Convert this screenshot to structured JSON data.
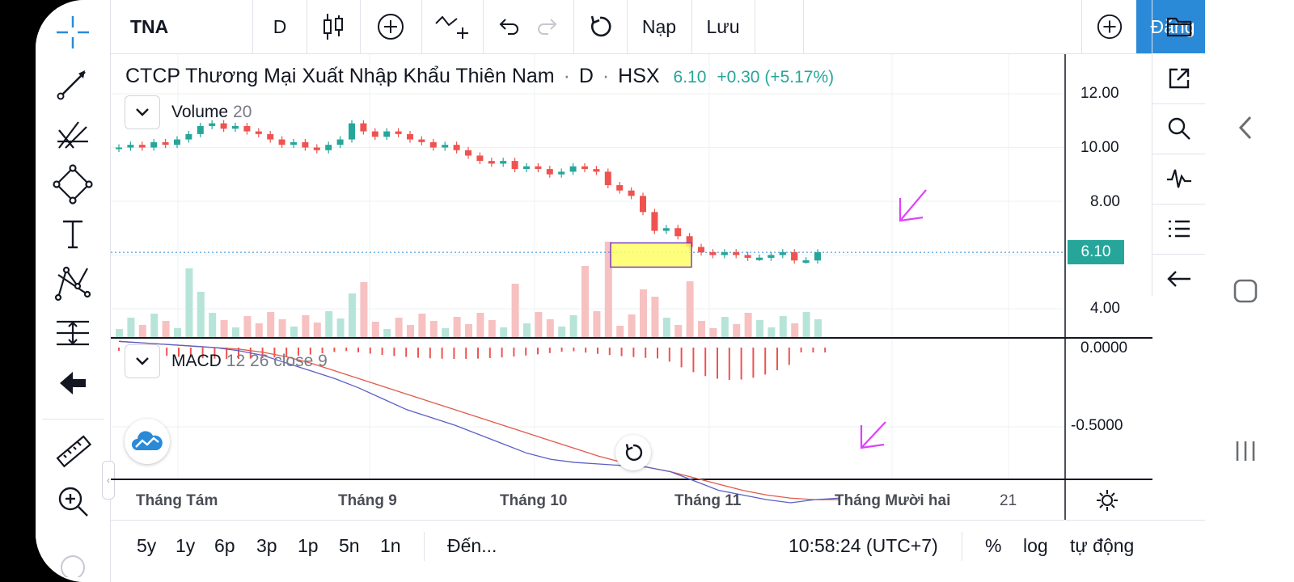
{
  "toolbar": {
    "symbol": "TNA",
    "interval": "D",
    "load_label": "Nạp",
    "save_label": "Lưu",
    "signup_label": "Đăng"
  },
  "legend": {
    "title": "CTCP Thương Mại Xuất Nhập Khẩu Thiên Nam",
    "sep1": "·",
    "interval": "D",
    "sep2": "·",
    "exchange": "HSX",
    "price": "6.10",
    "change": "+0.30 (+5.17%)"
  },
  "volume_legend": {
    "name": "Volume",
    "param": "20"
  },
  "macd_legend": {
    "name": "MACD",
    "params": "12 26 close 9"
  },
  "price_axis": [
    "12.00",
    "10.00",
    "8.00",
    "4.00"
  ],
  "macd_axis": [
    "0.0000",
    "-0.5000"
  ],
  "last_price_tag": "6.10",
  "time_axis": [
    "Tháng Tám",
    "Tháng 9",
    "Tháng 10",
    "Tháng 11",
    "Tháng Mười hai",
    "21"
  ],
  "ranges": [
    "5y",
    "1y",
    "6p",
    "3p",
    "1p",
    "5n",
    "1n"
  ],
  "goto_label": "Đến...",
  "clock": "10:58:24 (UTC+7)",
  "percent_label": "%",
  "log_label": "log",
  "auto_label": "tự động",
  "colors": {
    "up": "#26a69a",
    "down": "#ef5350",
    "accent": "#2b8ad8",
    "annotation": "#e040fb",
    "highlight": "#ffff66"
  },
  "chart_data": {
    "type": "candlestick",
    "series": [
      {
        "name": "price_close",
        "values": [
          10.0,
          10.1,
          10.0,
          10.2,
          10.1,
          10.3,
          10.5,
          10.8,
          10.9,
          10.7,
          10.8,
          10.6,
          10.5,
          10.3,
          10.1,
          10.2,
          10.0,
          9.9,
          10.1,
          10.3,
          10.9,
          10.6,
          10.4,
          10.6,
          10.5,
          10.3,
          10.2,
          10.0,
          10.1,
          9.9,
          9.7,
          9.5,
          9.4,
          9.5,
          9.2,
          9.3,
          9.2,
          9.0,
          9.1,
          9.3,
          9.2,
          9.1,
          8.6,
          8.4,
          8.2,
          7.6,
          6.9,
          7.0,
          6.7,
          6.3,
          6.1,
          6.0,
          6.1,
          6.0,
          5.9,
          5.9,
          6.0,
          6.1,
          5.8,
          5.8,
          6.1
        ]
      },
      {
        "name": "macd",
        "values": [
          0.04,
          0.03,
          0.02,
          0.01,
          0.0,
          -0.02,
          -0.05,
          -0.1,
          -0.15,
          -0.2,
          -0.26,
          -0.33,
          -0.4,
          -0.45,
          -0.5,
          -0.56,
          -0.62,
          -0.68,
          -0.72,
          -0.74,
          -0.75,
          -0.76,
          -0.77,
          -0.8,
          -0.86,
          -0.92,
          -0.95,
          -0.98,
          -1.0,
          -0.98,
          -0.97
        ]
      },
      {
        "name": "signal",
        "values": [
          0.04,
          0.03,
          0.02,
          0.01,
          0.0,
          -0.01,
          -0.03,
          -0.06,
          -0.1,
          -0.15,
          -0.2,
          -0.25,
          -0.3,
          -0.35,
          -0.4,
          -0.45,
          -0.5,
          -0.55,
          -0.6,
          -0.65,
          -0.7,
          -0.74,
          -0.77,
          -0.8,
          -0.84,
          -0.88,
          -0.92,
          -0.95,
          -0.97,
          -0.98,
          -0.98
        ]
      }
    ],
    "ylim": [
      3.5,
      12.8
    ],
    "title": "",
    "xlabel": "",
    "ylabel": ""
  }
}
